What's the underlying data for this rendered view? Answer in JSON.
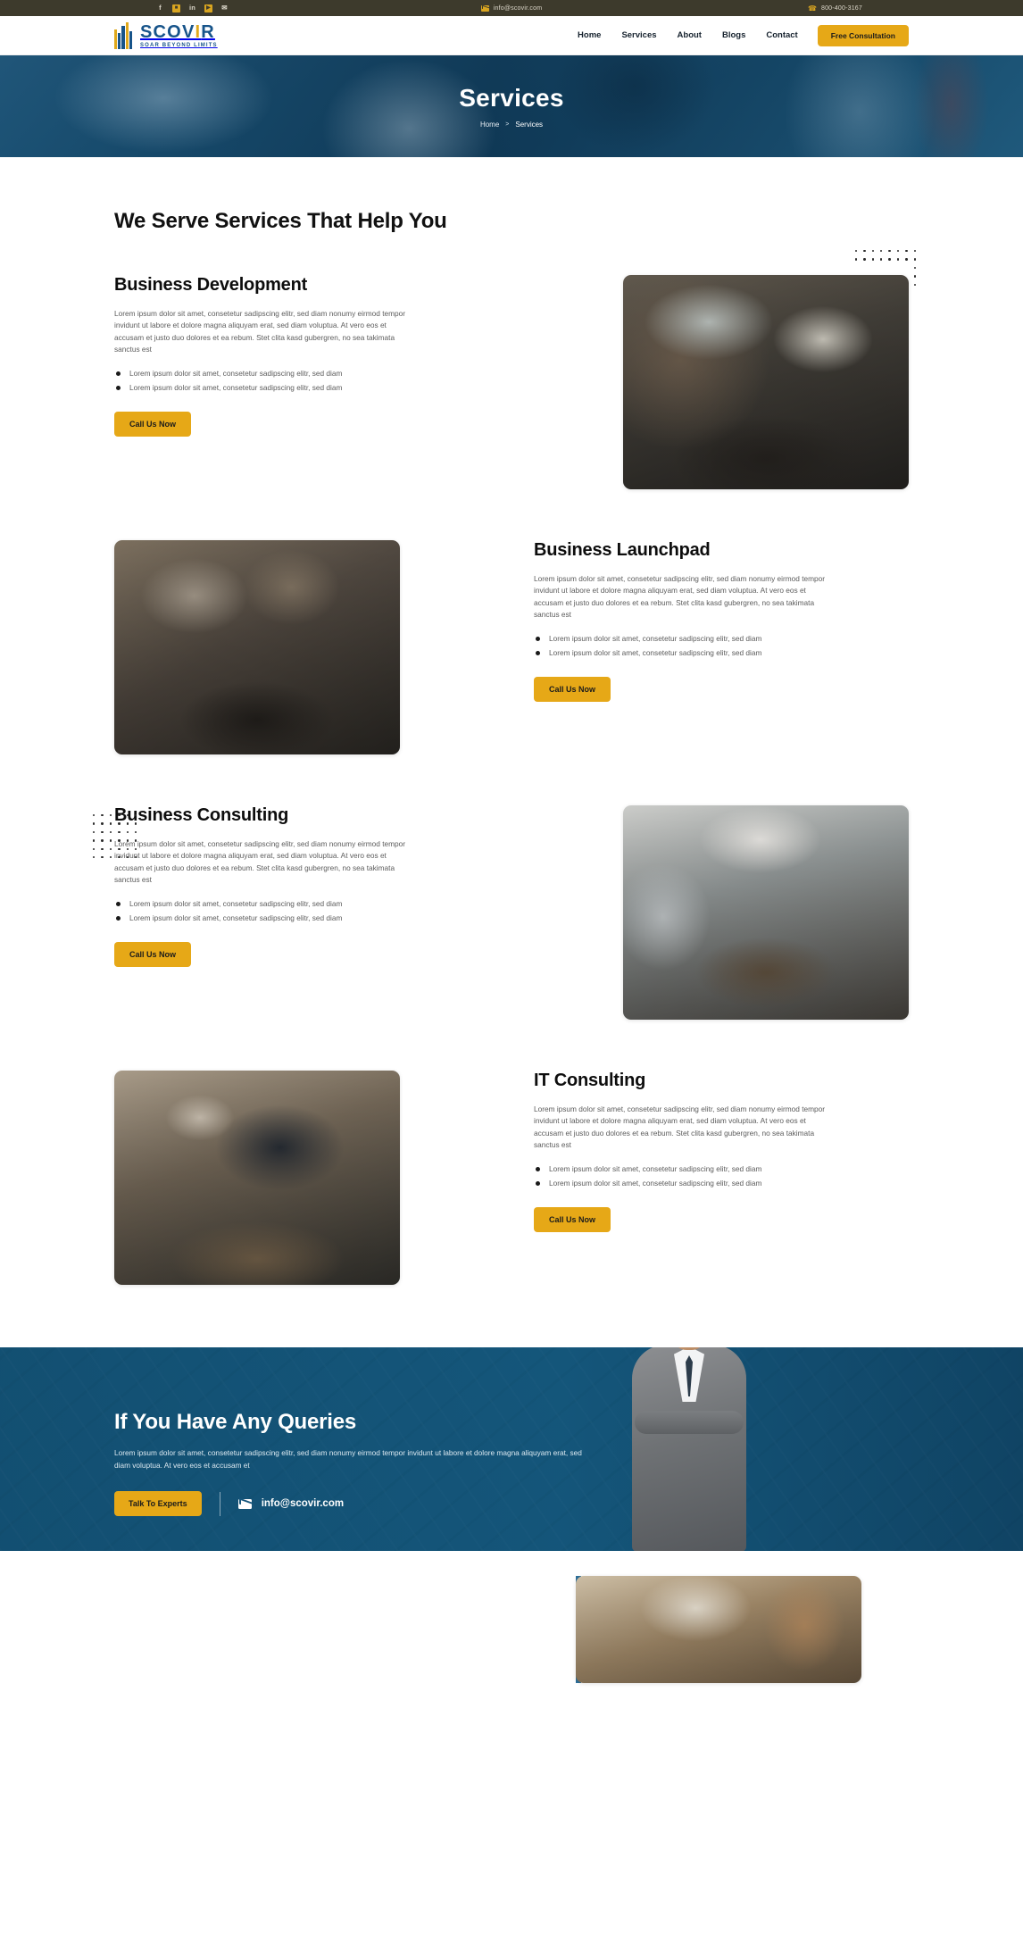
{
  "topbar": {
    "social": [
      {
        "name": "facebook-icon",
        "glyph": "f",
        "boxed": false
      },
      {
        "name": "instagram-icon",
        "glyph": "■",
        "boxed": true
      },
      {
        "name": "linkedin-icon",
        "glyph": "in",
        "boxed": false
      },
      {
        "name": "youtube-icon",
        "glyph": "▶",
        "boxed": true
      },
      {
        "name": "twitter-icon",
        "glyph": "✉",
        "boxed": false
      }
    ],
    "email": "info@scovir.com",
    "phone": "800-400-3167"
  },
  "header": {
    "logo_name_main": "SCOV",
    "logo_name_accent": "I",
    "logo_name_end": "R",
    "logo_tagline": "SOAR BEYOND LIMITS",
    "nav": [
      {
        "label": "Home"
      },
      {
        "label": "Services"
      },
      {
        "label": "About"
      },
      {
        "label": "Blogs"
      },
      {
        "label": "Contact"
      }
    ],
    "cta_label": "Free Consultation"
  },
  "hero": {
    "title": "Services",
    "breadcrumb_home": "Home",
    "breadcrumb_sep": ">",
    "breadcrumb_current": "Services"
  },
  "main": {
    "section_title": "We Serve Services That Help You",
    "body_text": "Lorem ipsum dolor sit amet, consetetur sadipscing elitr, sed diam nonumy eirmod tempor invidunt ut labore et dolore magna aliquyam erat, sed diam voluptua. At vero eos et accusam et justo duo dolores et ea rebum. Stet clita kasd gubergren, no sea takimata sanctus est",
    "bullet_text": "Lorem ipsum dolor sit amet, consetetur sadipscing elitr, sed diam",
    "call_label": "Call Us Now",
    "services": [
      {
        "title": "Business Development",
        "image": "conference-room-presentation-photo"
      },
      {
        "title": "Business Launchpad",
        "image": "team-working-laptops-photo"
      },
      {
        "title": "Business Consulting",
        "image": "meeting-room-discussion-photo"
      },
      {
        "title": "IT Consulting",
        "image": "laptop-code-desk-photo"
      }
    ]
  },
  "cta": {
    "title": "If You Have Any Queries",
    "text": "Lorem ipsum dolor sit amet, consetetur sadipscing elitr, sed diam nonumy eirmod tempor invidunt ut labore et dolore magna aliquyam erat, sed diam voluptua. At vero eos et accusam et",
    "button_label": "Talk To Experts",
    "email": "info@scovir.com"
  },
  "colors": {
    "accent_gold": "#e6a817",
    "brand_blue": "#17548a",
    "hero_blue": "#16567d",
    "topbar_dark": "#3d3a2c"
  }
}
